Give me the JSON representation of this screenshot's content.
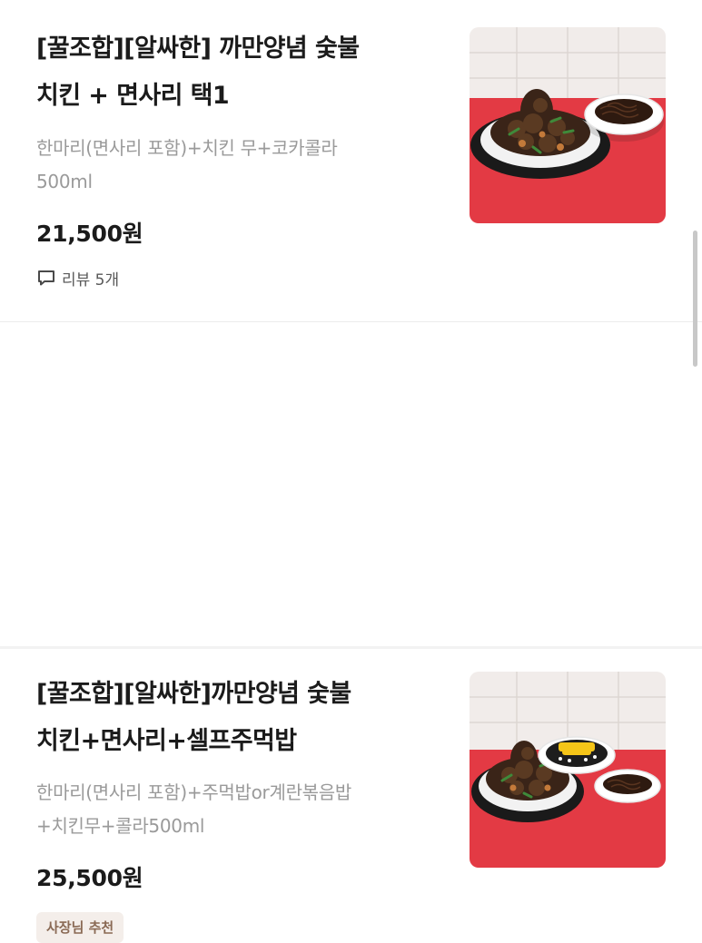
{
  "items": [
    {
      "title_line1": "[꿀조합][알싸한] 까만양념 숯불",
      "title_line2": "치킨 + 면사리 택1",
      "desc_line1": "한마리(면사리 포함)+치킨 무+코카콜라",
      "desc_line2": "500ml",
      "price": "21,500원",
      "review_label": "리뷰 5개",
      "image_icon": "chicken-with-noodles-photo"
    },
    {
      "title_line1": "[꿀조합][알싸한]까만양념 숯불",
      "title_line2": "치킨+면사리+셀프주먹밥",
      "desc_line1": "한마리(면사리 포함)+주먹밥or계란볶음밥",
      "desc_line2": "+치킨무+콜라500ml",
      "price": "25,500원",
      "badge": "사장님 추천",
      "image_icon": "chicken-noodles-riceball-photo"
    }
  ],
  "colors": {
    "title": "#1b1b1b",
    "desc": "#9a9a9a",
    "badge_bg": "#f4eeea",
    "badge_text": "#8a6a55",
    "photo_red": "#e33a44"
  }
}
